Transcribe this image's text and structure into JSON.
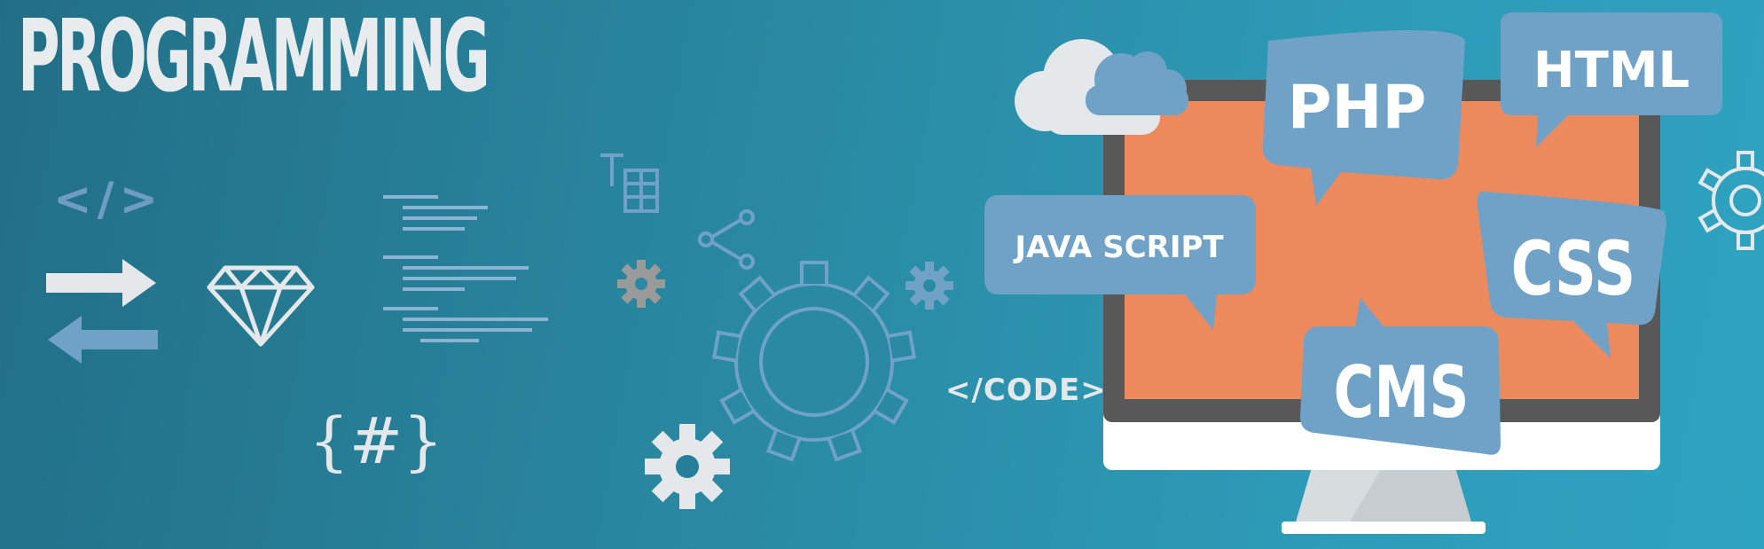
{
  "banner": {
    "title": "PROGRAMMING",
    "code_tag": "</>",
    "hash_symbol": "{#}",
    "code_label": "</CODE>"
  },
  "bubbles": {
    "php": "PHP",
    "html": "HTML",
    "javascript": "JAVA SCRIPT",
    "css": "CSS",
    "cms": "CMS"
  },
  "icons": [
    "code-brackets-icon",
    "swap-arrows-icon",
    "diamond-icon",
    "text-lines-icon",
    "text-table-icon",
    "share-icon",
    "gear-icon",
    "cloud-icon",
    "monitor-icon"
  ],
  "colors": {
    "background": "#2a8aa3",
    "bubble": "#6fa2c6",
    "screen": "#ec8a5e",
    "light": "#e4e8ea",
    "accent_blue": "#6f9cc5"
  }
}
